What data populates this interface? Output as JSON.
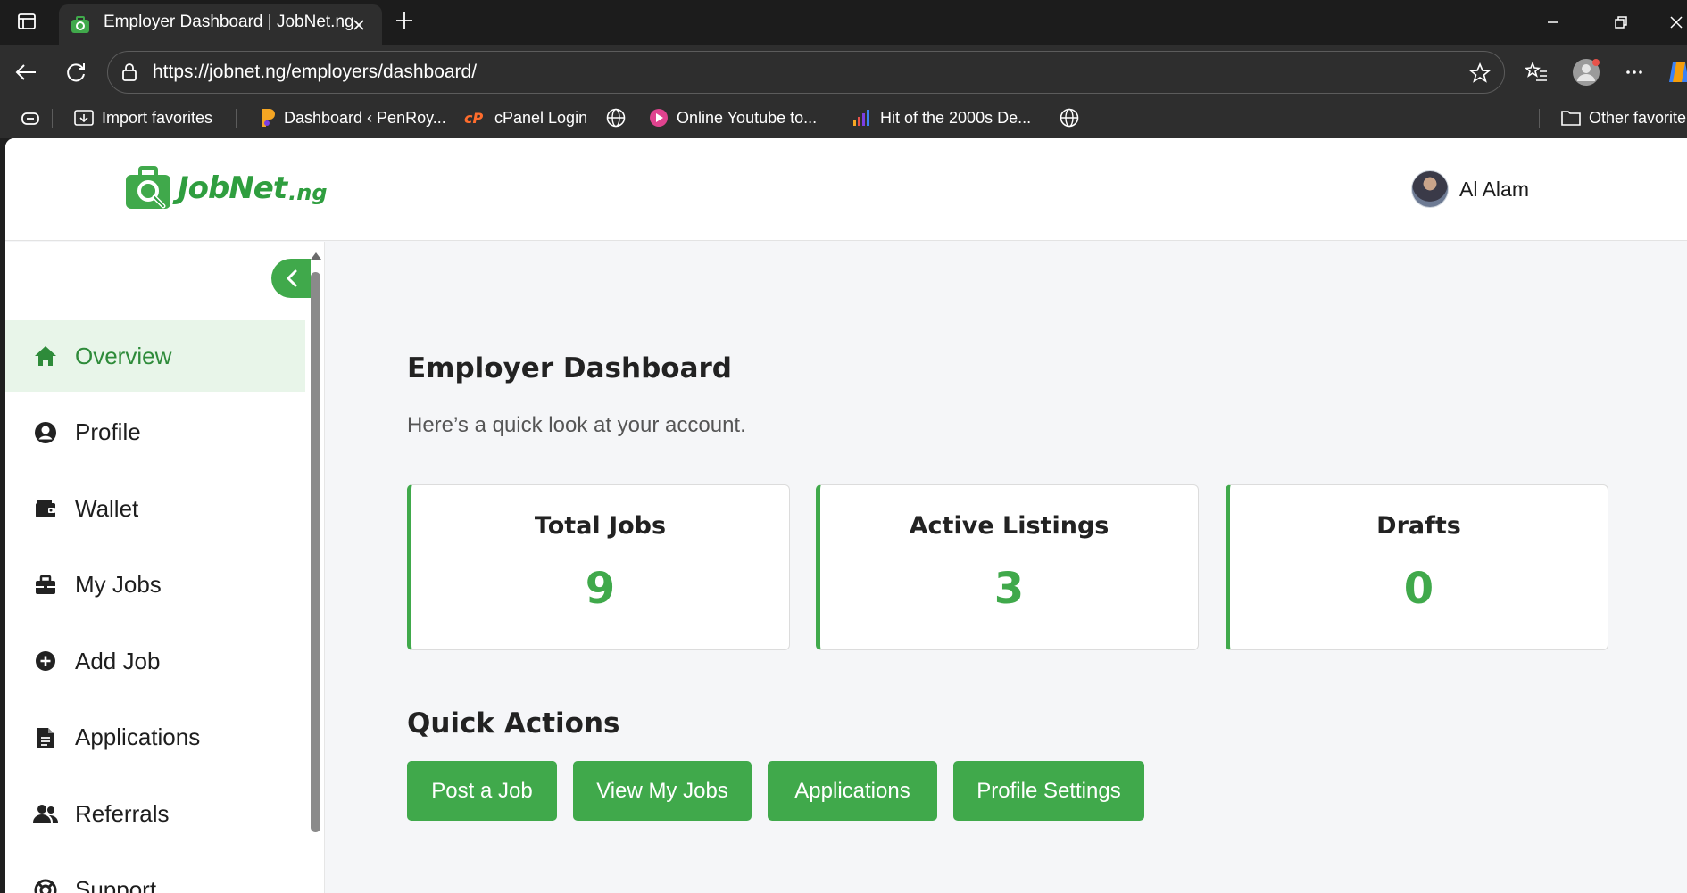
{
  "browser": {
    "tab_title": "Employer Dashboard | JobNet.ng",
    "url": "https://jobnet.ng/employers/dashboard/",
    "bookmarks": [
      {
        "label": "Import favorites",
        "icon": "import-icon"
      },
      {
        "label": "Dashboard ‹ PenRoy...",
        "icon": "penroyal-icon"
      },
      {
        "label": "cPanel Login",
        "icon": "cpanel-icon"
      },
      {
        "label": "",
        "icon": "globe-icon"
      },
      {
        "label": "Online Youtube to...",
        "icon": "youtube-converter-icon"
      },
      {
        "label": "Hit of the 2000s De...",
        "icon": "equalizer-icon"
      },
      {
        "label": "",
        "icon": "globe-icon"
      }
    ],
    "other_favorites": "Other favorite"
  },
  "site": {
    "logo_text": "JobNet",
    "logo_suffix": ".ng",
    "brand_color": "#40a94b",
    "user_name": "Al Alam"
  },
  "sidebar": {
    "items": [
      {
        "label": "Overview",
        "icon": "home-icon",
        "active": true
      },
      {
        "label": "Profile",
        "icon": "user-circle-icon"
      },
      {
        "label": "Wallet",
        "icon": "wallet-icon"
      },
      {
        "label": "My Jobs",
        "icon": "briefcase-icon"
      },
      {
        "label": "Add Job",
        "icon": "plus-circle-icon"
      },
      {
        "label": "Applications",
        "icon": "document-icon"
      },
      {
        "label": "Referrals",
        "icon": "users-icon"
      },
      {
        "label": "Support",
        "icon": "lifebuoy-icon"
      }
    ]
  },
  "main": {
    "title": "Employer Dashboard",
    "subtitle": "Here’s a quick look at your account.",
    "stats": [
      {
        "label": "Total Jobs",
        "value": "9"
      },
      {
        "label": "Active Listings",
        "value": "3"
      },
      {
        "label": "Drafts",
        "value": "0"
      }
    ],
    "quick_actions_title": "Quick Actions",
    "quick_actions": [
      "Post a Job",
      "View My Jobs",
      "Applications",
      "Profile Settings"
    ]
  }
}
